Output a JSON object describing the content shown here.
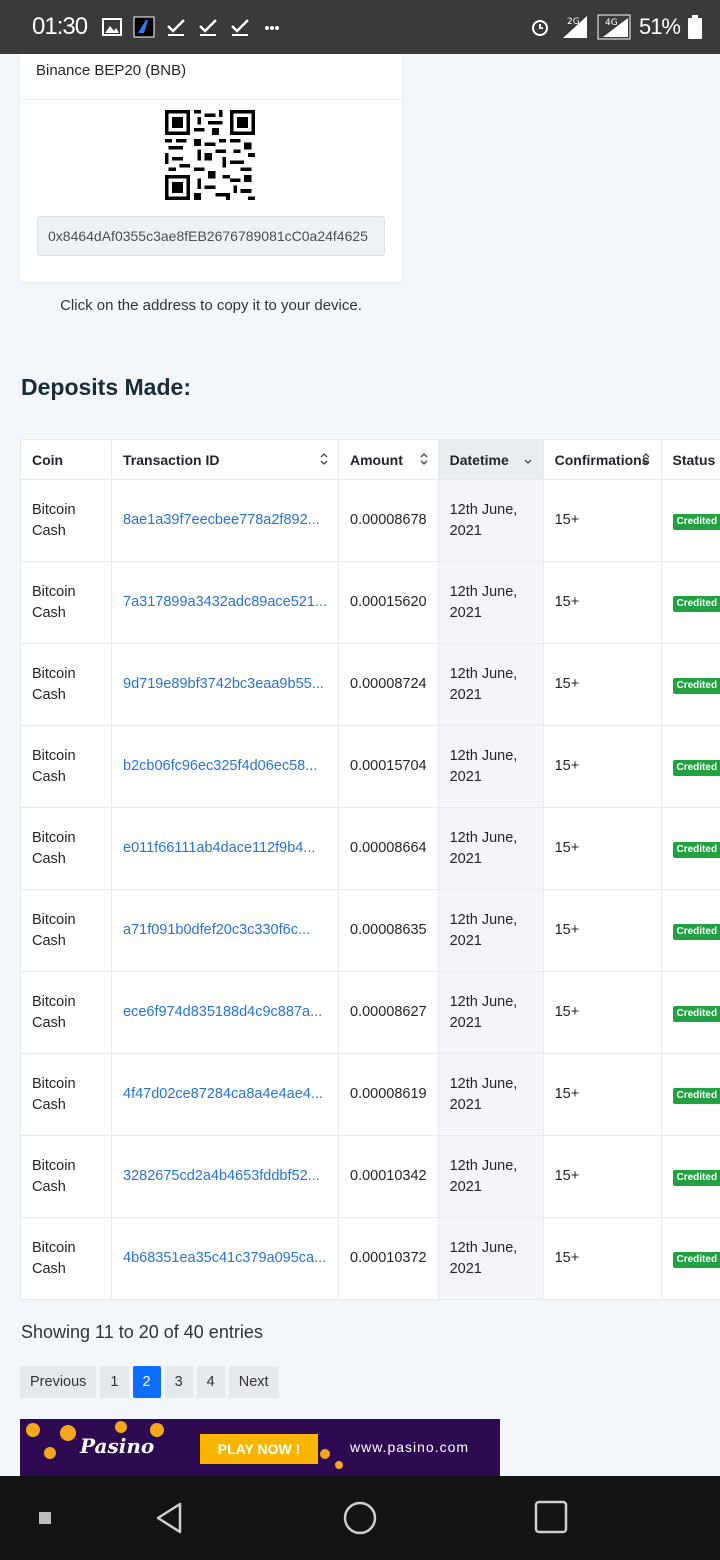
{
  "status_bar": {
    "time": "01:30",
    "network_1": "2G",
    "network_2": "4G",
    "battery_percent": "51%"
  },
  "wallet": {
    "network_label": "Binance BEP20 (BNB)",
    "address": "0x8464dAf0355c3ae8fEB2676789081cC0a24f4625",
    "copy_hint": "Click on the address to copy it to your device."
  },
  "deposits": {
    "title": "Deposits Made:",
    "columns": [
      "Coin",
      "Transaction ID",
      "Amount",
      "Datetime",
      "Confirmations",
      "Status"
    ],
    "rows": [
      {
        "coin": "Bitcoin Cash",
        "txid": "8ae1a39f7eecbee778a2f892...",
        "amount": "0.00008678",
        "date": "12th June, 2021",
        "confirmations": "15+",
        "status": "Credited"
      },
      {
        "coin": "Bitcoin Cash",
        "txid": "7a317899a3432adc89ace521...",
        "amount": "0.00015620",
        "date": "12th June, 2021",
        "confirmations": "15+",
        "status": "Credited"
      },
      {
        "coin": "Bitcoin Cash",
        "txid": "9d719e89bf3742bc3eaa9b55...",
        "amount": "0.00008724",
        "date": "12th June, 2021",
        "confirmations": "15+",
        "status": "Credited"
      },
      {
        "coin": "Bitcoin Cash",
        "txid": "b2cb06fc96ec325f4d06ec58...",
        "amount": "0.00015704",
        "date": "12th June, 2021",
        "confirmations": "15+",
        "status": "Credited"
      },
      {
        "coin": "Bitcoin Cash",
        "txid": "e011f66111ab4dace112f9b4...",
        "amount": "0.00008664",
        "date": "12th June, 2021",
        "confirmations": "15+",
        "status": "Credited"
      },
      {
        "coin": "Bitcoin Cash",
        "txid": "a71f091b0dfef20c3c330f6c...",
        "amount": "0.00008635",
        "date": "12th June, 2021",
        "confirmations": "15+",
        "status": "Credited"
      },
      {
        "coin": "Bitcoin Cash",
        "txid": "ece6f974d835188d4c9c887a...",
        "amount": "0.00008627",
        "date": "12th June, 2021",
        "confirmations": "15+",
        "status": "Credited"
      },
      {
        "coin": "Bitcoin Cash",
        "txid": "4f47d02ce87284ca8a4e4ae4...",
        "amount": "0.00008619",
        "date": "12th June, 2021",
        "confirmations": "15+",
        "status": "Credited"
      },
      {
        "coin": "Bitcoin Cash",
        "txid": "3282675cd2a4b4653fddbf52...",
        "amount": "0.00010342",
        "date": "12th June, 2021",
        "confirmations": "15+",
        "status": "Credited"
      },
      {
        "coin": "Bitcoin Cash",
        "txid": "4b68351ea35c41c379a095ca...",
        "amount": "0.00010372",
        "date": "12th June, 2021",
        "confirmations": "15+",
        "status": "Credited"
      }
    ],
    "entries_info": "Showing 11 to 20 of 40 entries"
  },
  "pagination": {
    "previous": "Previous",
    "pages": [
      "1",
      "2",
      "3",
      "4"
    ],
    "current": "2",
    "next": "Next"
  },
  "ad": {
    "brand": "Pasino",
    "cta": "PLAY NOW !",
    "url": "www.pasino.com"
  },
  "colors": {
    "status_bar": "#3a3a3a",
    "link": "#2a72d4",
    "badge": "#21a142",
    "active_page": "#0d6efd",
    "ad_background": "#2e0a52",
    "ad_button": "#f7b500"
  },
  "icons": {
    "status_left": [
      "gallery-icon",
      "app-icon",
      "check-icon",
      "check-icon",
      "check-icon",
      "more-icon"
    ],
    "status_right": [
      "alarm-icon",
      "signal-icon",
      "signal-icon",
      "battery-icon"
    ],
    "nav": [
      "recents-square-icon",
      "back-triangle-icon",
      "home-circle-icon",
      "overview-square-icon"
    ]
  }
}
